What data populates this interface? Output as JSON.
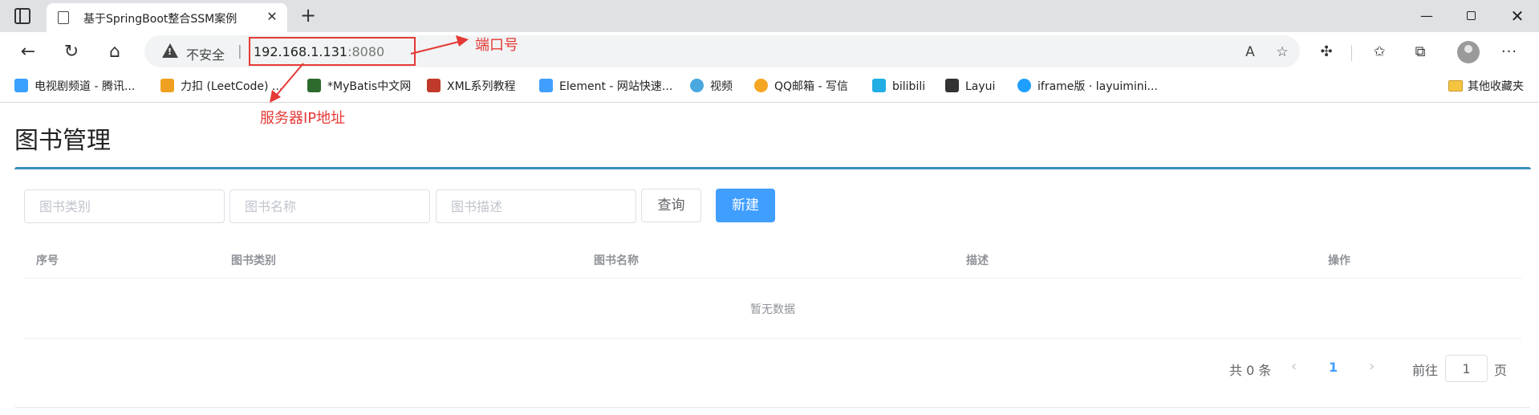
{
  "browser": {
    "tab_title": "基于SpringBoot整合SSM案例",
    "tab_close": "✕",
    "new_tab": "+",
    "insecure_label": "不安全",
    "address_separator": "|",
    "url_host": "192.168.1.131",
    "url_port": ":8080",
    "window": {
      "minimize": "—",
      "close": "✕"
    }
  },
  "bookmarks": [
    {
      "label": "电视剧频道 - 腾讯...",
      "color": "#3aa0ff"
    },
    {
      "label": "力扣 (LeetCode) ...",
      "color": "#f0a020"
    },
    {
      "label": "*MyBatis中文网",
      "color": "#2d6a2d"
    },
    {
      "label": "XML系列教程",
      "color": "#c0392b"
    },
    {
      "label": "Element - 网站快速...",
      "color": "#409eff"
    },
    {
      "label": "视频",
      "color": "#4aa8e0"
    },
    {
      "label": "QQ邮箱 - 写信",
      "color": "#f5a623"
    },
    {
      "label": "bilibili",
      "color": "#23ade5"
    },
    {
      "label": "Layui",
      "color": "#333333"
    },
    {
      "label": "iframe版 · layuimini...",
      "color": "#1e9fff"
    }
  ],
  "bookmarks_folder": "其他收藏夹",
  "annotations": {
    "port": "端口号",
    "ip": "服务器IP地址",
    "color": "#e53935"
  },
  "page": {
    "title": "图书管理",
    "filters": {
      "type_placeholder": "图书类别",
      "name_placeholder": "图书名称",
      "desc_placeholder": "图书描述"
    },
    "query_button": "查询",
    "new_button": "新建",
    "table": {
      "columns": [
        "序号",
        "图书类别",
        "图书名称",
        "描述",
        "操作"
      ],
      "rows": [],
      "empty_text": "暂无数据"
    },
    "pagination": {
      "total_text": "共 0 条",
      "prev": "‹",
      "current_page": "1",
      "next": "›",
      "goto_label": "前往",
      "goto_value": "1",
      "page_unit": "页"
    },
    "accent_color": "#409eff",
    "panel_border_color": "#3c8dbc"
  }
}
